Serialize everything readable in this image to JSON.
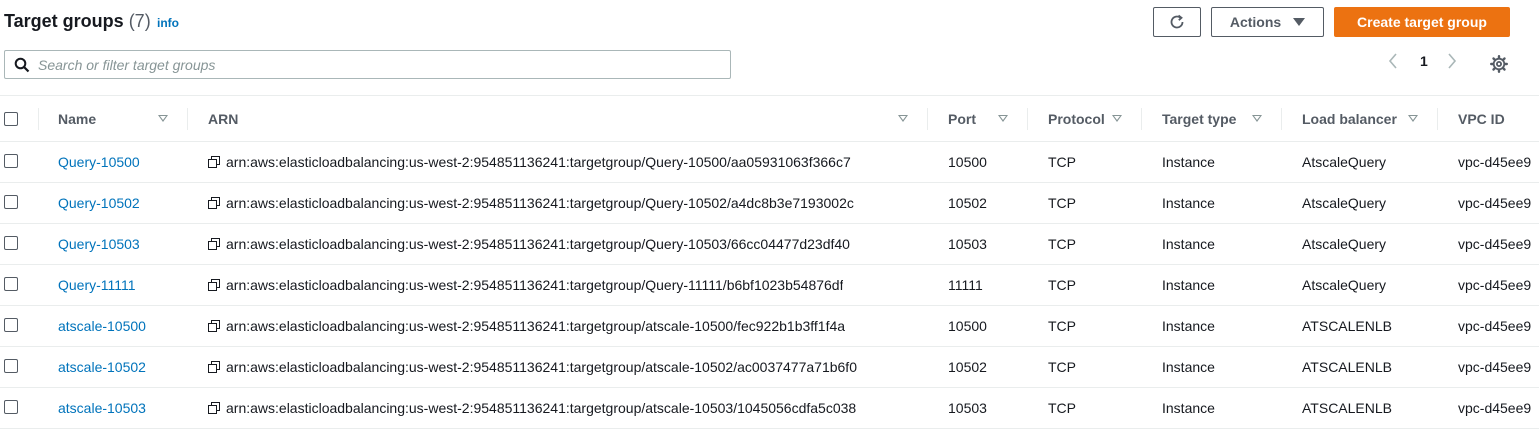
{
  "header": {
    "title": "Target groups",
    "count": "(7)",
    "info": "info",
    "actions_label": "Actions",
    "create_label": "Create target group"
  },
  "search": {
    "placeholder": "Search or filter target groups"
  },
  "pagination": {
    "prev": "‹",
    "page": "1",
    "next": "›"
  },
  "table": {
    "columns": [
      "Name",
      "ARN",
      "Port",
      "Protocol",
      "Target type",
      "Load balancer",
      "VPC ID"
    ],
    "rows": [
      {
        "name": "Query-10500",
        "arn": "arn:aws:elasticloadbalancing:us-west-2:954851136241:targetgroup/Query-10500/aa05931063f366c7",
        "port": "10500",
        "protocol": "TCP",
        "target_type": "Instance",
        "load_balancer": "AtscaleQuery",
        "vpc": "vpc-d45ee9"
      },
      {
        "name": "Query-10502",
        "arn": "arn:aws:elasticloadbalancing:us-west-2:954851136241:targetgroup/Query-10502/a4dc8b3e7193002c",
        "port": "10502",
        "protocol": "TCP",
        "target_type": "Instance",
        "load_balancer": "AtscaleQuery",
        "vpc": "vpc-d45ee9"
      },
      {
        "name": "Query-10503",
        "arn": "arn:aws:elasticloadbalancing:us-west-2:954851136241:targetgroup/Query-10503/66cc04477d23df40",
        "port": "10503",
        "protocol": "TCP",
        "target_type": "Instance",
        "load_balancer": "AtscaleQuery",
        "vpc": "vpc-d45ee9"
      },
      {
        "name": "Query-11111",
        "arn": "arn:aws:elasticloadbalancing:us-west-2:954851136241:targetgroup/Query-11111/b6bf1023b54876df",
        "port": "11111",
        "protocol": "TCP",
        "target_type": "Instance",
        "load_balancer": "AtscaleQuery",
        "vpc": "vpc-d45ee9"
      },
      {
        "name": "atscale-10500",
        "arn": "arn:aws:elasticloadbalancing:us-west-2:954851136241:targetgroup/atscale-10500/fec922b1b3ff1f4a",
        "port": "10500",
        "protocol": "TCP",
        "target_type": "Instance",
        "load_balancer": "ATSCALENLB",
        "vpc": "vpc-d45ee9"
      },
      {
        "name": "atscale-10502",
        "arn": "arn:aws:elasticloadbalancing:us-west-2:954851136241:targetgroup/atscale-10502/ac0037477a71b6f0",
        "port": "10502",
        "protocol": "TCP",
        "target_type": "Instance",
        "load_balancer": "ATSCALENLB",
        "vpc": "vpc-d45ee9"
      },
      {
        "name": "atscale-10503",
        "arn": "arn:aws:elasticloadbalancing:us-west-2:954851136241:targetgroup/atscale-10503/1045056cdfa5c038",
        "port": "10503",
        "protocol": "TCP",
        "target_type": "Instance",
        "load_balancer": "ATSCALENLB",
        "vpc": "vpc-d45ee9"
      }
    ]
  },
  "colors": {
    "primary_button": "#ec7211",
    "link": "#0073bb",
    "text": "#16191f",
    "muted": "#545b64",
    "border": "#eaeded"
  },
  "icons": [
    "refresh-icon",
    "caret-down-icon",
    "search-icon",
    "chevron-left-icon",
    "chevron-right-icon",
    "gear-icon",
    "copy-icon",
    "sort-icon",
    "checkbox-icon"
  ]
}
